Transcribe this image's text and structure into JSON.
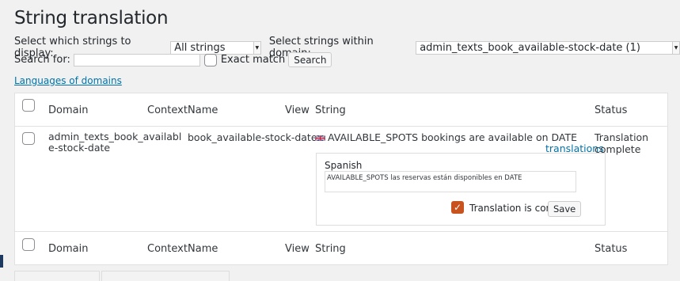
{
  "page": {
    "title": "String translation"
  },
  "filters": {
    "display_label": "Select which strings to display:",
    "display_value": "All strings",
    "domain_label": "Select strings within domain:",
    "domain_value": "admin_texts_book_available-stock-date (1)",
    "search_label": "Search for:",
    "search_value": "",
    "exact_match_label": "Exact match",
    "search_button": "Search"
  },
  "links": {
    "languages_of_domains": "Languages of domains"
  },
  "table": {
    "columns": [
      "Domain",
      "Context",
      "Name",
      "View",
      "String",
      "Status"
    ],
    "row": {
      "domain_line1": "admin_texts_book_availabl",
      "domain_line2": "e-stock-date",
      "context": "",
      "name": "book_available-stock-date",
      "view": "",
      "string": "AVAILABLE_SPOTS bookings are available on DATE",
      "translations_link": "translations",
      "status": "Translation complete"
    },
    "translation_panel": {
      "language": "Spanish",
      "text": "AVAILABLE_SPOTS las reservas están disponibles en DATE",
      "complete_label": "Translation is complete",
      "complete_checked": true,
      "save_button": "Save"
    }
  },
  "icons": {
    "flag": "uk-flag-icon",
    "checkbox": "checkbox-icon",
    "dropdown": "dropdown-arrow-icon"
  },
  "colors": {
    "link": "#0073aa",
    "checkbox_checked": "#c9531f"
  }
}
